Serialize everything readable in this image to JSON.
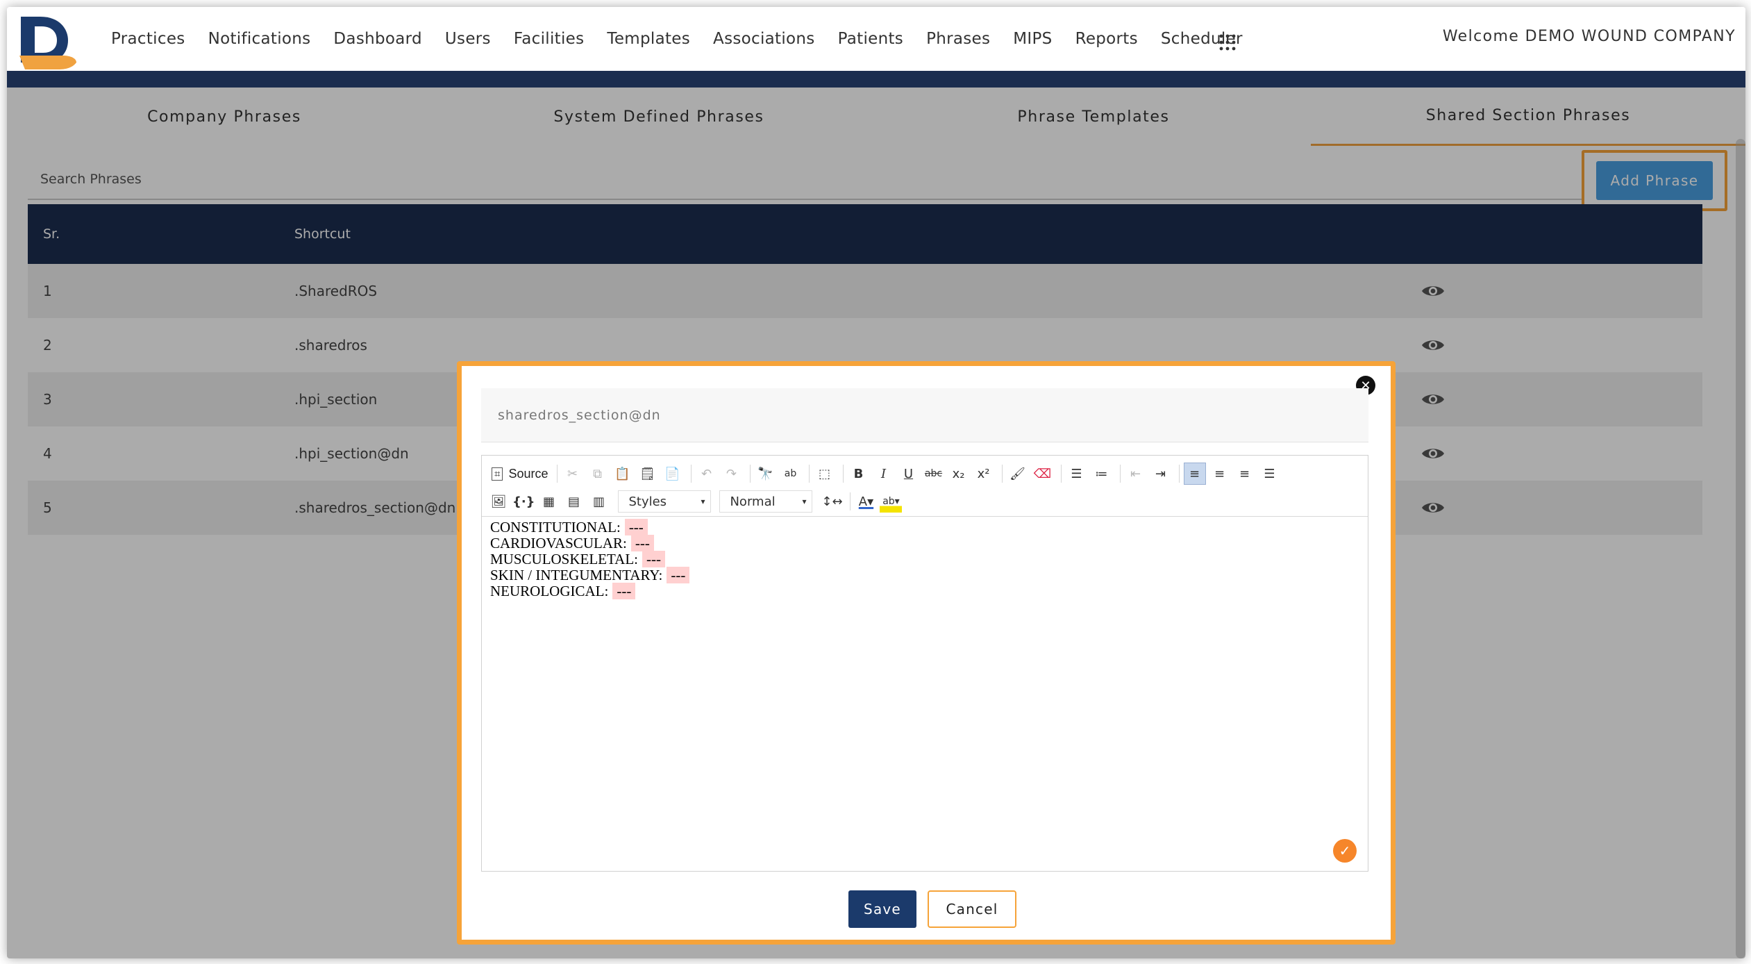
{
  "nav": {
    "logo_icon": "d-logo-icon",
    "items": [
      "Practices",
      "Notifications",
      "Dashboard",
      "Users",
      "Facilities",
      "Templates",
      "Associations",
      "Patients",
      "Phrases",
      "MIPS",
      "Reports",
      "Scheduler"
    ],
    "apps_icon": "grid-apps-icon",
    "welcome": "Welcome DEMO WOUND COMPANY"
  },
  "tabs": [
    {
      "label": "Company Phrases",
      "active": false
    },
    {
      "label": "System Defined Phrases",
      "active": false
    },
    {
      "label": "Phrase Templates",
      "active": false
    },
    {
      "label": "Shared Section Phrases",
      "active": true
    }
  ],
  "search": {
    "placeholder": "Search Phrases",
    "value": ""
  },
  "add_button": "Add Phrase",
  "table": {
    "headers": {
      "sr": "Sr.",
      "shortcut": "Shortcut"
    },
    "rows": [
      {
        "sr": "1",
        "shortcut": ".SharedROS"
      },
      {
        "sr": "2",
        "shortcut": ".sharedros"
      },
      {
        "sr": "3",
        "shortcut": ".hpi_section"
      },
      {
        "sr": "4",
        "shortcut": ".hpi_section@dn"
      },
      {
        "sr": "5",
        "shortcut": ".sharedros_section@dn"
      }
    ],
    "row_action_icon": "eye-icon"
  },
  "modal": {
    "close_icon": "close-icon",
    "title_value": "sharedros_section@dn",
    "toolbar": {
      "source_label": "Source",
      "styles_label": "Styles",
      "format_label": "Normal"
    },
    "content_lines": [
      {
        "label": "CONSTITUTIONAL:",
        "placeholder": "---"
      },
      {
        "label": "CARDIOVASCULAR:",
        "placeholder": "---"
      },
      {
        "label": "MUSCULOSKELETAL:",
        "placeholder": "---"
      },
      {
        "label": "SKIN / INTEGUMENTARY:",
        "placeholder": "---"
      },
      {
        "label": "NEUROLOGICAL:",
        "placeholder": "---"
      }
    ],
    "save_label": "Save",
    "cancel_label": "Cancel"
  },
  "colors": {
    "navy": "#1b2d4f",
    "accent_orange": "#f6a339",
    "add_button_blue": "#4a9fe0",
    "placeholder_highlight": "#ffd0d0"
  }
}
